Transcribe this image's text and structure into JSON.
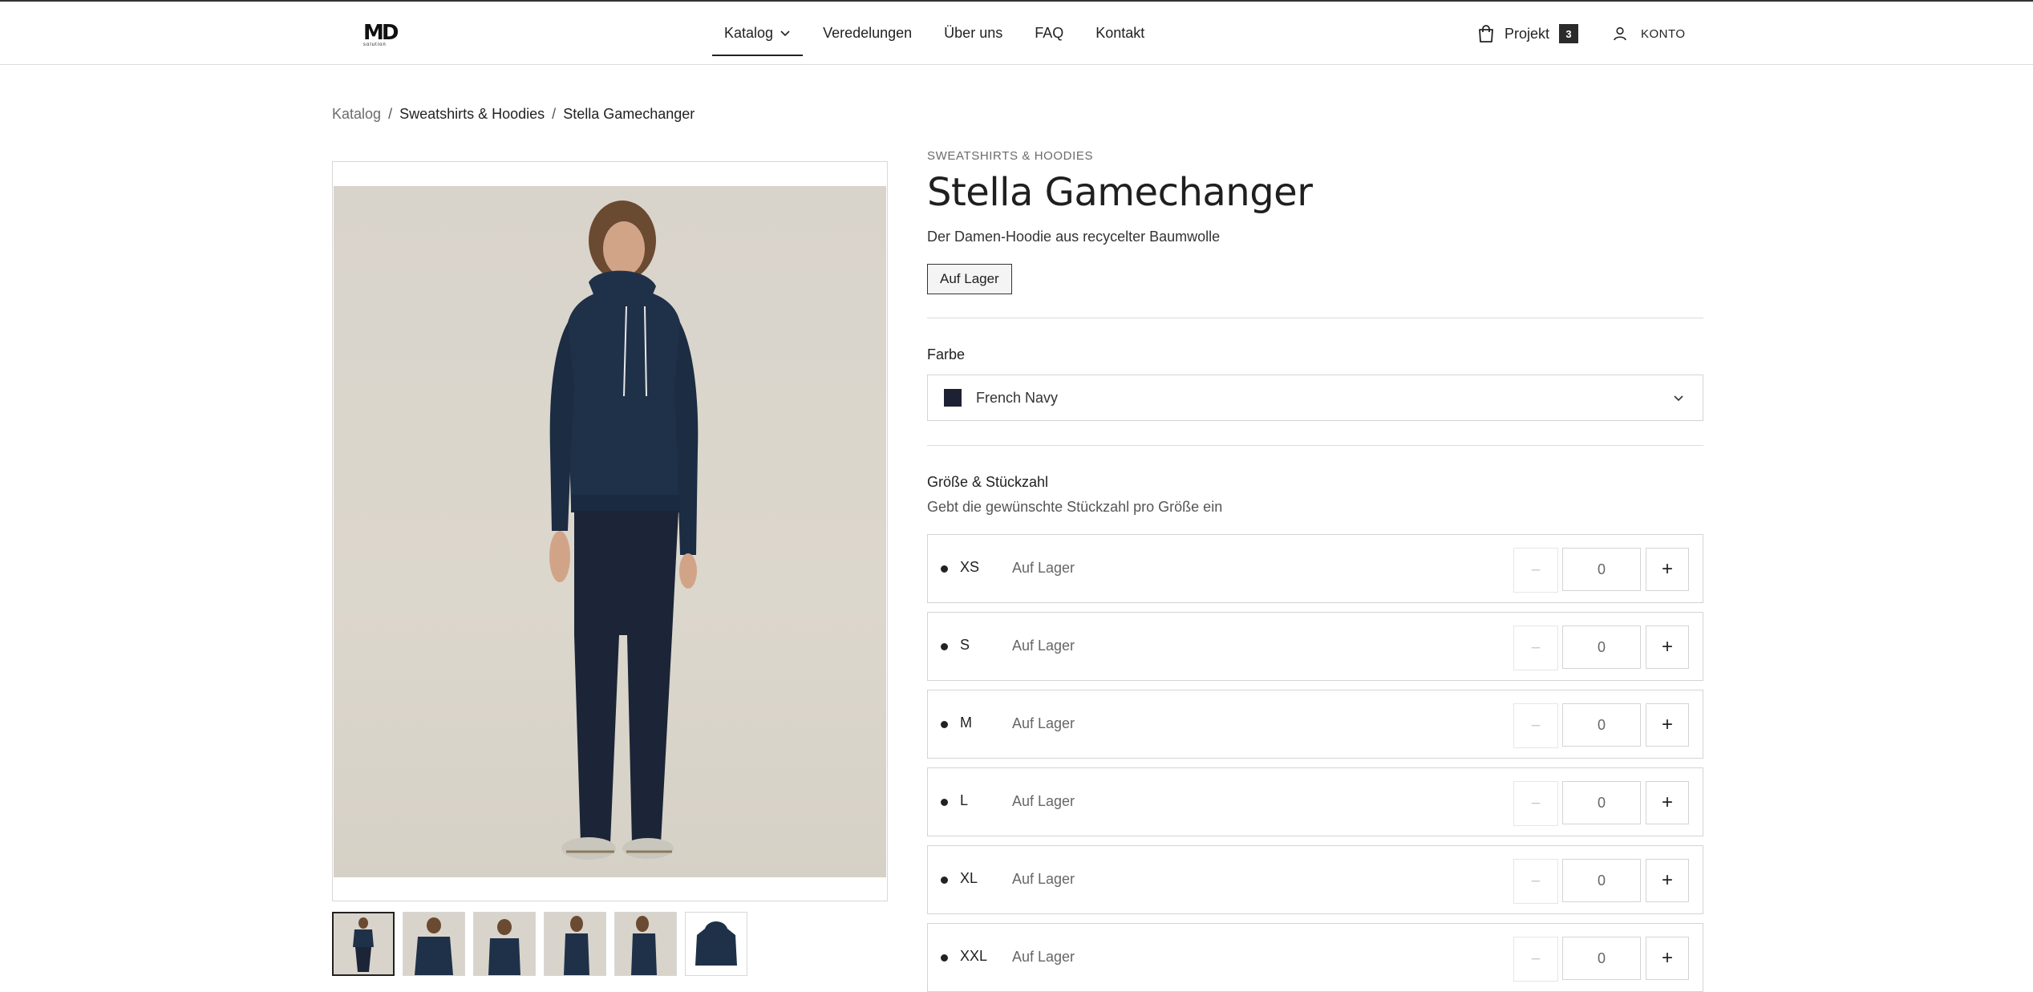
{
  "header": {
    "logo": {
      "mark": "MD",
      "sub": "solution"
    },
    "nav": [
      "Katalog",
      "Veredelungen",
      "Über uns",
      "FAQ",
      "Kontakt"
    ],
    "projekt_label": "Projekt",
    "projekt_count": "3",
    "konto_label": "KONTO"
  },
  "breadcrumb": [
    "Katalog",
    "Sweatshirts & Hoodies",
    "Stella Gamechanger"
  ],
  "product": {
    "category": "SWEATSHIRTS & HOODIES",
    "title": "Stella Gamechanger",
    "subtitle": "Der Damen-Hoodie aus recycelter Baumwolle",
    "stock_badge": "Auf Lager",
    "color_label": "Farbe",
    "color_value": "French Navy",
    "color_hex": "#1e2133",
    "size_label": "Größe & Stückzahl",
    "size_hint": "Gebt die gewünschte Stückzahl pro Größe ein",
    "sizes": [
      {
        "size": "XS",
        "availability": "Auf Lager",
        "qty": "0"
      },
      {
        "size": "S",
        "availability": "Auf Lager",
        "qty": "0"
      },
      {
        "size": "M",
        "availability": "Auf Lager",
        "qty": "0"
      },
      {
        "size": "L",
        "availability": "Auf Lager",
        "qty": "0"
      },
      {
        "size": "XL",
        "availability": "Auf Lager",
        "qty": "0"
      },
      {
        "size": "XXL",
        "availability": "Auf Lager",
        "qty": "0"
      }
    ],
    "minus_symbol": "−",
    "plus_symbol": "+"
  },
  "icons": {
    "bag": "shopping-bag-icon",
    "user": "user-icon",
    "chevron": "chevron-down-icon"
  },
  "colors": {
    "hoodie": "#1f3149",
    "jeans": "#1c2437",
    "background_photo": "#d9d4cb"
  }
}
